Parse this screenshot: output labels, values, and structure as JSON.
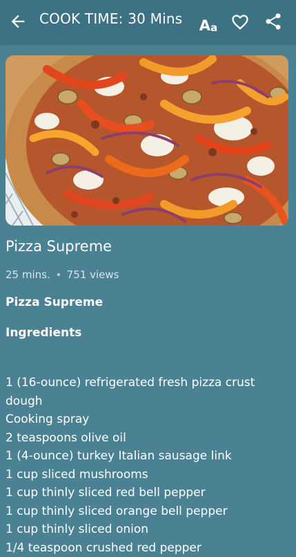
{
  "appbar": {
    "title": "COOK TIME: 30 Mins",
    "font_button_big": "A",
    "font_button_small": "a"
  },
  "recipe": {
    "title": "Pizza Supreme",
    "time": "25 mins.",
    "views": "751 views",
    "subtitle": "Pizza Supreme",
    "ingredients_heading": "Ingredients",
    "ingredients": [
      "1 (16-ounce) refrigerated fresh pizza crust dough",
      "Cooking spray",
      "2 teaspoons olive oil",
      "1 (4-ounce) turkey Italian sausage link",
      "1 cup sliced mushrooms",
      "1 cup thinly sliced red bell pepper",
      "1 cup thinly sliced orange bell pepper",
      "1 cup thinly sliced onion",
      "1/4 teaspoon crushed red pepper"
    ]
  },
  "colors": {
    "background": "#4a8294",
    "appbar": "#3d7284",
    "text": "#ffffff"
  },
  "icons": {
    "back": "arrow-left-icon",
    "font": "font-size-icon",
    "favorite": "heart-outline-icon",
    "share": "share-icon"
  }
}
